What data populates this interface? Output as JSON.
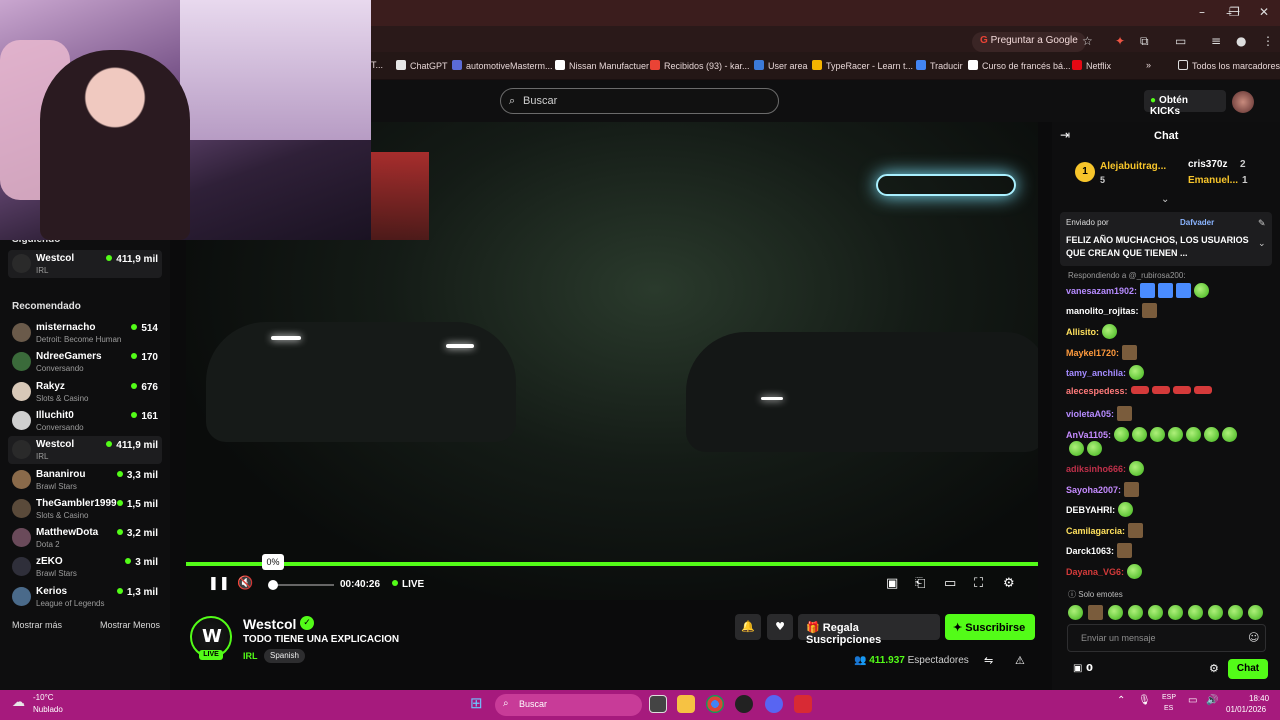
{
  "browser": {
    "ask_google": "Preguntar a Google",
    "bookmarks": [
      {
        "label": "ChatGPT",
        "color": "#e6e6e6"
      },
      {
        "label": "automotiveMasterm...",
        "color": "#5b6bd6"
      },
      {
        "label": "Nissan Manufactuer",
        "color": "#ffffff"
      },
      {
        "label": "Recibidos (93) - kar...",
        "color": "#ea4335"
      },
      {
        "label": "User area",
        "color": "#3b7ad8"
      },
      {
        "label": "TypeRacer - Learn t...",
        "color": "#f4b400"
      },
      {
        "label": "Traducir",
        "color": "#4285f4"
      },
      {
        "label": "Curso de francés bá...",
        "color": "#ffffff"
      },
      {
        "label": "Netflix",
        "color": "#e50914"
      }
    ],
    "all_bookmarks": "Todos los marcadores",
    "partial_tab": "T..."
  },
  "header": {
    "search_placeholder": "Buscar",
    "kicks_label": "Obtén KICKs"
  },
  "sidebar": {
    "following_label": "Siguiendo",
    "following": [
      {
        "name": "Westcol",
        "category": "IRL",
        "viewers": "411,9 mil",
        "avatar": "#2a2a2a"
      }
    ],
    "recommended_label": "Recomendado",
    "recommended": [
      {
        "name": "misternacho",
        "category": "Detroit: Become Human",
        "viewers": "514",
        "avatar": "#6a5a4a"
      },
      {
        "name": "NdreeGamers",
        "category": "Conversando",
        "viewers": "170",
        "avatar": "#3a6a3a"
      },
      {
        "name": "Rakyz",
        "category": "Slots & Casino",
        "viewers": "676",
        "avatar": "#d8c8b8"
      },
      {
        "name": "Illuchit0",
        "category": "Conversando",
        "viewers": "161",
        "avatar": "#cfcfcf"
      },
      {
        "name": "Westcol",
        "category": "IRL",
        "viewers": "411,9 mil",
        "avatar": "#2a2a2a"
      },
      {
        "name": "Bananirou",
        "category": "Brawl Stars",
        "viewers": "3,3 mil",
        "avatar": "#8a6a4a"
      },
      {
        "name": "TheGambler1999",
        "category": "Slots & Casino",
        "viewers": "1,5 mil",
        "avatar": "#5a4a3a"
      },
      {
        "name": "MatthewDota",
        "category": "Dota 2",
        "viewers": "3,2 mil",
        "avatar": "#6a4a5a"
      },
      {
        "name": "zEKO",
        "category": "Brawl Stars",
        "viewers": "3 mil",
        "avatar": "#2f2f3a"
      },
      {
        "name": "Kerios",
        "category": "League of Legends",
        "viewers": "1,3 mil",
        "avatar": "#4a6a8a"
      }
    ],
    "show_more": "Mostrar más",
    "show_less": "Mostrar Menos"
  },
  "player": {
    "volume_tooltip": "0%",
    "volume_level": 0,
    "elapsed": "00:40:26",
    "live_label": "LIVE"
  },
  "stream": {
    "streamer": "Westcol",
    "avatar_letter": "W",
    "live_badge": "LIVE",
    "title": "TODO TIENE UNA EXPLICACION",
    "category": "IRL",
    "language": "Spanish",
    "gift_label": "Regala Suscripciones",
    "subscribe_label": "Suscribirse",
    "viewers_count": "411.937",
    "viewers_label": "Espectadores"
  },
  "chat": {
    "title": "Chat",
    "leaderboard": [
      {
        "rank": "1",
        "name": "Alejabuitrag...",
        "points": "5",
        "color": "#f7c52b"
      },
      {
        "name": "cris370z",
        "points": "2",
        "color": "#ffffff"
      },
      {
        "name": "Emanuel...",
        "points": "1",
        "color": "#f7c52b"
      }
    ],
    "pinned_by": "Enviado por",
    "pinned_user": "Dafvader",
    "pinned_message": "FELIZ AÑO MUCHACHOS, LOS USUARIOS QUE CREAN QUE TIENEN ...",
    "reply_to": "Respondiendo a @_rubirosa200:",
    "messages": [
      {
        "user": "vanesazam1902:",
        "color": "#b68bff"
      },
      {
        "user": "manolito_rojitas:",
        "color": "#ffffff"
      },
      {
        "user": "Allisito:",
        "color": "#ffe15e"
      },
      {
        "user": "Maykel1720:",
        "color": "#ff9a3d"
      },
      {
        "user": "tamy_anchila:",
        "color": "#a48bff"
      },
      {
        "user": "alecespedess:",
        "color": "#ff7a7a"
      },
      {
        "user": "violetaA05:",
        "color": "#b68bff"
      },
      {
        "user": "AnVa1105:",
        "color": "#c58bff"
      },
      {
        "user": "adiksinho666:",
        "color": "#c0304a"
      },
      {
        "user": "Sayoha2007:",
        "color": "#c58bff"
      },
      {
        "user": "DEBYAHRI:",
        "color": "#ffffff"
      },
      {
        "user": "Camilagarcia:",
        "color": "#ffe15e"
      },
      {
        "user": "Darck1063:",
        "color": "#ffffff"
      },
      {
        "user": "Dayana_VG6:",
        "color": "#d43a3a"
      }
    ],
    "emotes_only": "Solo emotes",
    "input_placeholder": "Enviar un mensaje",
    "points": "0",
    "send_label": "Chat"
  },
  "taskbar": {
    "temperature": "-10°C",
    "weather": "Nublado",
    "search_placeholder": "Buscar",
    "lang1": "ESP",
    "lang2": "ES",
    "time": "18:40",
    "date": "01/01/2026"
  }
}
